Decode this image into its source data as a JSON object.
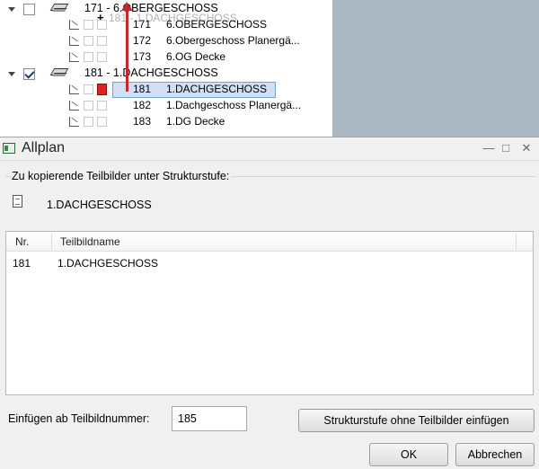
{
  "tree": {
    "groups": [
      {
        "title": "171 - 6.OBERGESCHOSS",
        "checked": false,
        "rows": [
          {
            "num": "171",
            "name": "6.OBERGESCHOSS"
          },
          {
            "num": "172",
            "name": "6.Obergeschoss Planergä..."
          },
          {
            "num": "173",
            "name": "6.OG Decke"
          }
        ]
      },
      {
        "title": "181 - 1.DACHGESCHOSS",
        "checked": true,
        "rows": [
          {
            "num": "181",
            "name": "1.DACHGESCHOSS"
          },
          {
            "num": "182",
            "name": "1.Dachgeschoss Planergä..."
          },
          {
            "num": "183",
            "name": "1.DG Decke"
          }
        ]
      }
    ],
    "drag_ghost": "181 - 1.DACHGESCHOSS"
  },
  "dialog": {
    "title": "Allplan",
    "group_label": "Zu kopierende Teilbilder unter Strukturstufe:",
    "folder_name": "1.DACHGESCHOSS",
    "table": {
      "columns": [
        "Nr.",
        "Teilbildname"
      ],
      "rows": [
        {
          "nr": "181",
          "name": "1.DACHGESCHOSS"
        }
      ]
    },
    "insert_label": "Einfügen ab Teilbildnummer:",
    "insert_value": "185",
    "btn_struct": "Strukturstufe ohne Teilbilder einfügen",
    "btn_ok": "OK",
    "btn_cancel": "Abbrechen"
  },
  "icons": {
    "window_minimize": "minimize-icon",
    "window_maximize": "maximize-icon",
    "window_close": "close-icon"
  }
}
